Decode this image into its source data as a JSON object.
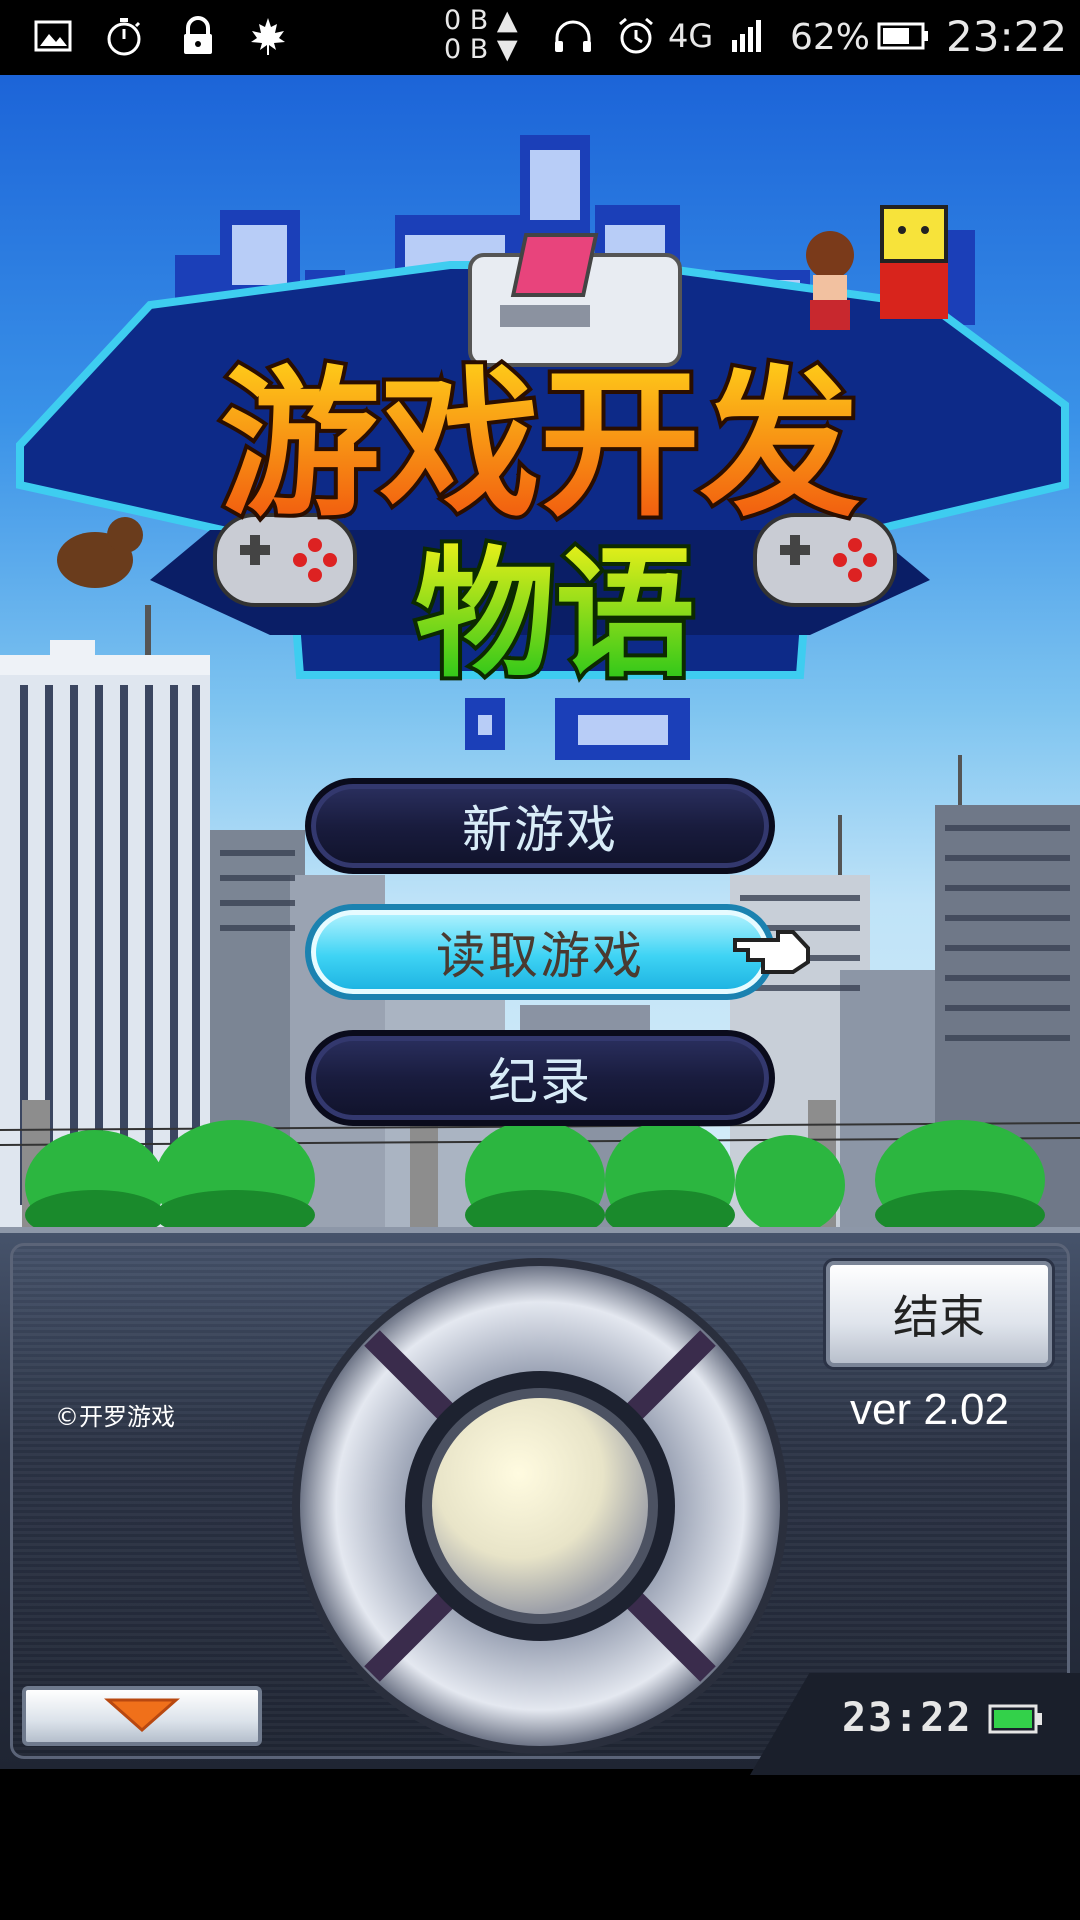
{
  "status_bar": {
    "icons": [
      "gallery-icon",
      "stopwatch-icon",
      "lock-icon",
      "maple-leaf-icon"
    ],
    "net_up": "0 B",
    "net_down": "0 B",
    "network": "4G",
    "battery_percent": "62%",
    "time": "23:22"
  },
  "game": {
    "title": "游戏开发物语",
    "menu": {
      "new_game": "新游戏",
      "load_game": "读取游戏",
      "records": "纪录"
    }
  },
  "panel": {
    "copyright": "©开罗游戏",
    "end_button": "结束",
    "version": "ver 2.02",
    "clock": "23:22"
  },
  "colors": {
    "sky_top": "#1c64d8",
    "menu_dark": "#191c3e",
    "menu_selected": "#3ed3f4",
    "panel": "#2c3446",
    "battery_green": "#33d14a"
  }
}
